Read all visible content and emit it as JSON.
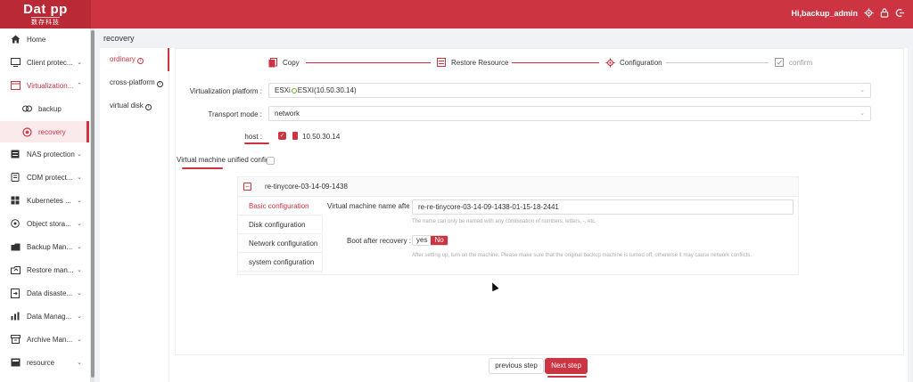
{
  "header": {
    "logo_main": "Dat  pp",
    "logo_sub": "数存科技",
    "greeting": "Hi,backup_admin",
    "icons": [
      "gear-icon",
      "lock-icon",
      "logout-icon"
    ]
  },
  "sidebar": {
    "items": [
      {
        "label": "Home",
        "icon": "home-icon"
      },
      {
        "label": "Client protec...",
        "icon": "client-icon"
      },
      {
        "label": "Virtualization...",
        "icon": "virtualization-icon"
      },
      {
        "label": "backup",
        "icon": "backup-icon"
      },
      {
        "label": "recovery",
        "icon": "recovery-icon"
      },
      {
        "label": "NAS protection",
        "icon": "nas-icon"
      },
      {
        "label": "CDM protect...",
        "icon": "cdm-icon"
      },
      {
        "label": "Kubernetes ...",
        "icon": "kubernetes-icon"
      },
      {
        "label": "Object stora...",
        "icon": "object-storage-icon"
      },
      {
        "label": "Backup Man...",
        "icon": "backup-manage-icon"
      },
      {
        "label": "Restore man...",
        "icon": "restore-manage-icon"
      },
      {
        "label": "Data disaste...",
        "icon": "disaster-icon"
      },
      {
        "label": "Data Manag...",
        "icon": "data-manage-icon"
      },
      {
        "label": "Archive Man...",
        "icon": "archive-icon"
      },
      {
        "label": "resource",
        "icon": "resource-icon"
      }
    ]
  },
  "breadcrumb": "recovery",
  "tabs": [
    {
      "label": "ordinary"
    },
    {
      "label": "cross-platform"
    },
    {
      "label": "virtual disk"
    }
  ],
  "steps": [
    {
      "label": "Copy"
    },
    {
      "label": "Restore Resource"
    },
    {
      "label": "Configuration"
    },
    {
      "label": "confirm"
    }
  ],
  "form": {
    "platform_label": "Virtualization platform :",
    "platform_prefix": "ESXi",
    "platform_value": "ESXI(10.50.30.14)",
    "transport_label": "Transport mode :",
    "transport_value": "network",
    "host_label": "host :",
    "host_value": "10.50.30.14",
    "unified_label": "Virtual machine unified configu"
  },
  "vm": {
    "name": "re-tinycore-03-14-09-1438",
    "config_tabs": [
      "Basic configuration",
      "Disk configuration",
      "Network configuration",
      "system configuration"
    ],
    "name_after_label": "Virtual machine name after r",
    "name_after_value": "re-re-tinycore-03-14-09-1438-01-15-18-2441",
    "name_hint": "The name can only be named with any combination of numbers, letters, -, etc.",
    "boot_label": "Boot after recovery :",
    "boot_yes": "yes",
    "boot_no": "No",
    "boot_hint": "After setting up, turn on the machine. Please make sure that the original backup machine is turned off, otherwise it may cause network conflicts."
  },
  "buttons": {
    "prev": "previous step",
    "next": "Next step"
  },
  "colors": {
    "brand": "#cd3441",
    "brand_dark": "#b92a36"
  }
}
